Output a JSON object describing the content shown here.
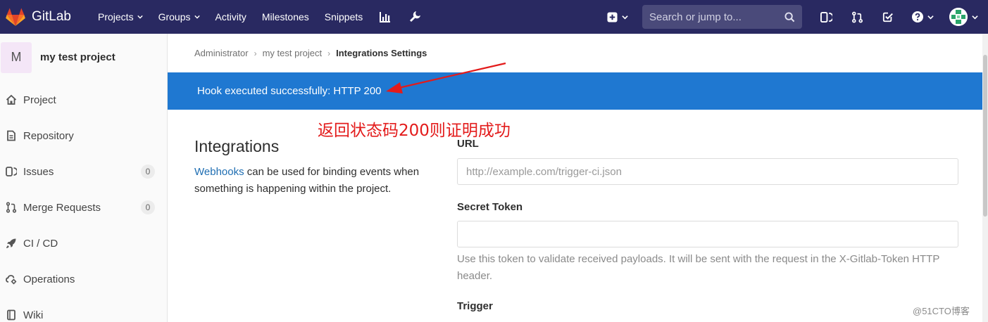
{
  "navbar": {
    "brand": "GitLab",
    "items": [
      {
        "label": "Projects",
        "has_caret": true
      },
      {
        "label": "Groups",
        "has_caret": true
      },
      {
        "label": "Activity",
        "has_caret": false
      },
      {
        "label": "Milestones",
        "has_caret": false
      },
      {
        "label": "Snippets",
        "has_caret": false
      }
    ],
    "icons": [
      "chart-icon",
      "wrench-icon"
    ],
    "search_placeholder": "Search or jump to...",
    "bg_color": "#292961"
  },
  "sidebar": {
    "avatar_letter": "M",
    "project_name": "my test project",
    "items": [
      {
        "label": "Project",
        "icon": "home-icon"
      },
      {
        "label": "Repository",
        "icon": "document-icon"
      },
      {
        "label": "Issues",
        "icon": "issues-icon",
        "badge": "0"
      },
      {
        "label": "Merge Requests",
        "icon": "merge-request-icon",
        "badge": "0"
      },
      {
        "label": "CI / CD",
        "icon": "rocket-icon"
      },
      {
        "label": "Operations",
        "icon": "cloud-gear-icon"
      },
      {
        "label": "Wiki",
        "icon": "book-icon"
      }
    ]
  },
  "breadcrumb": [
    "Administrator",
    "my test project",
    "Integrations Settings"
  ],
  "flash": {
    "message": "Hook executed successfully: HTTP 200",
    "color": "#1f78d1"
  },
  "annotation": {
    "text": "返回状态码200则证明成功",
    "color": "#e31b1b"
  },
  "integrations": {
    "title": "Integrations",
    "link_text": "Webhooks",
    "description_rest": " can be used for binding events when something is happening within the project."
  },
  "form": {
    "url_label": "URL",
    "url_placeholder": "http://example.com/trigger-ci.json",
    "token_label": "Secret Token",
    "token_value": "",
    "token_help": "Use this token to validate received payloads. It will be sent with the request in the X-Gitlab-Token HTTP header.",
    "trigger_label": "Trigger"
  },
  "watermark": "@51CTO博客"
}
